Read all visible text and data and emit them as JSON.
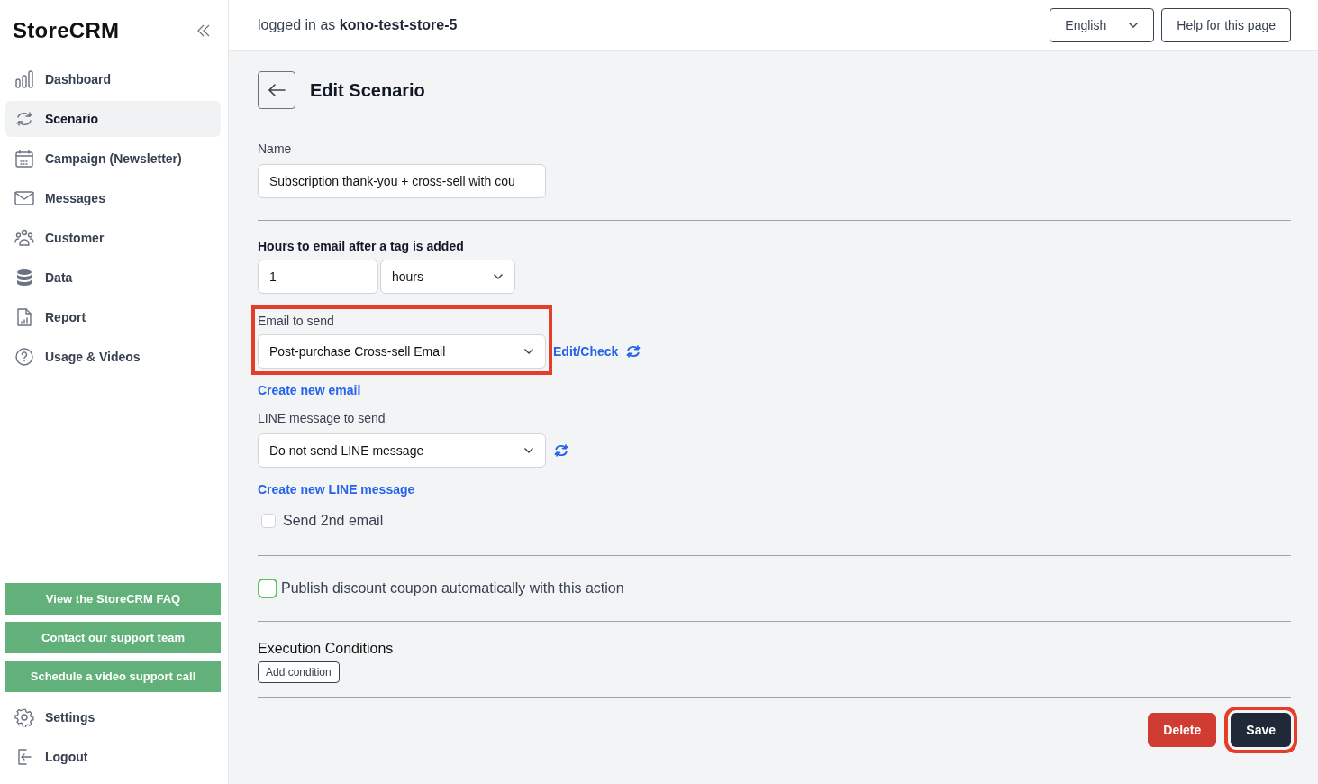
{
  "sidebar": {
    "logo": "StoreCRM",
    "items": [
      {
        "label": "Dashboard",
        "selected": false
      },
      {
        "label": "Scenario",
        "selected": true
      },
      {
        "label": "Campaign (Newsletter)",
        "selected": false
      },
      {
        "label": "Messages",
        "selected": false
      },
      {
        "label": "Customer",
        "selected": false
      },
      {
        "label": "Data",
        "selected": false
      },
      {
        "label": "Report",
        "selected": false
      },
      {
        "label": "Usage & Videos",
        "selected": false
      }
    ],
    "support_buttons": [
      "View the StoreCRM FAQ",
      "Contact our support team",
      "Schedule a video support call"
    ],
    "bottom_items": [
      {
        "label": "Settings"
      },
      {
        "label": "Logout"
      }
    ]
  },
  "header": {
    "logged_in_prefix": "logged in as",
    "user": "kono-test-store-5",
    "language": "English",
    "help_button": "Help for this page"
  },
  "page": {
    "title": "Edit Scenario",
    "name": {
      "label": "Name",
      "value": "Subscription thank-you + cross-sell with cou"
    },
    "delay": {
      "label": "Hours to email after a tag is added",
      "value": "1",
      "unit": "hours"
    },
    "email": {
      "label": "Email to send",
      "value": "Post-purchase Cross-sell Email",
      "highlighted": true,
      "edit_link": "Edit/Check",
      "create_link": "Create new email"
    },
    "line": {
      "label": "LINE message to send",
      "value": "Do not send LINE message",
      "create_link": "Create new LINE message"
    },
    "second_email": {
      "label": "Send 2nd email",
      "checked": false
    },
    "coupon": {
      "label": "Publish discount coupon automatically with this action",
      "checked": false
    },
    "conditions": {
      "title": "Execution Conditions",
      "add_button": "Add condition"
    },
    "delete_button": "Delete",
    "save_button": {
      "label": "Save",
      "highlighted": true
    }
  }
}
